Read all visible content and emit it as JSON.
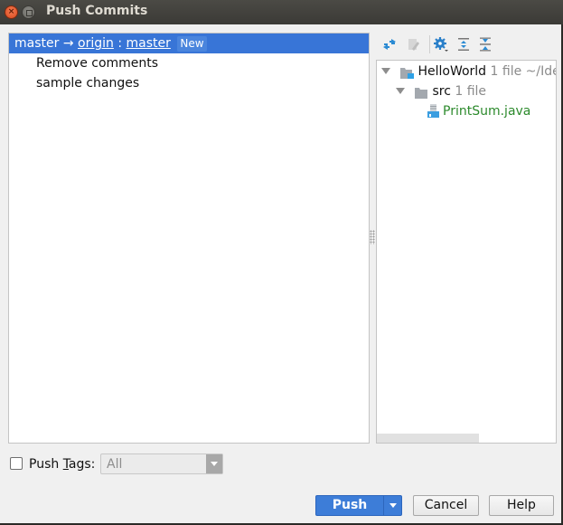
{
  "window": {
    "title": "Push Commits"
  },
  "commits_panel": {
    "branch": {
      "local": "master",
      "arrow": "→",
      "remote": "origin",
      "separator": ":",
      "remote_branch": "master",
      "badge": "New"
    },
    "commits": [
      {
        "message": "Remove comments"
      },
      {
        "message": "sample changes"
      }
    ]
  },
  "toolbar": {
    "icons": [
      "expand-collapse-arrows-icon",
      "edit-source-icon",
      "gear-icon",
      "expand-all-icon",
      "collapse-all-icon"
    ]
  },
  "file_tree": {
    "root": {
      "name": "HelloWorld",
      "meta": "1 file",
      "path": "~/Ide"
    },
    "folder": {
      "name": "src",
      "meta": "1 file"
    },
    "file": {
      "name": "PrintSum.java"
    }
  },
  "push_tags": {
    "label_before": "Push ",
    "label_mnemonic": "T",
    "label_after": "ags:",
    "checked": false,
    "select_value": "All"
  },
  "buttons": {
    "push": "Push",
    "cancel": "Cancel",
    "help": "Help"
  },
  "colors": {
    "selection": "#3875d7",
    "primary_button": "#3d7dd8",
    "java_file": "#2c8a2c"
  }
}
